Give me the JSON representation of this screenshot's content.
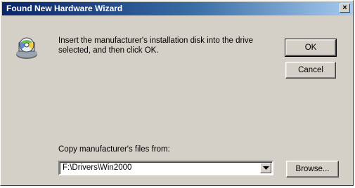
{
  "window": {
    "title": "Found New Hardware Wizard",
    "close_glyph": "×"
  },
  "dialog": {
    "icon": "cd-disk-icon",
    "message": "Insert the manufacturer's installation disk into the drive selected, and then click OK.",
    "ok_label": "OK",
    "cancel_label": "Cancel",
    "copy_label": "Copy manufacturer's files from:",
    "path_value": "F:\\Drivers\\Win2000",
    "browse_label": "Browse..."
  }
}
